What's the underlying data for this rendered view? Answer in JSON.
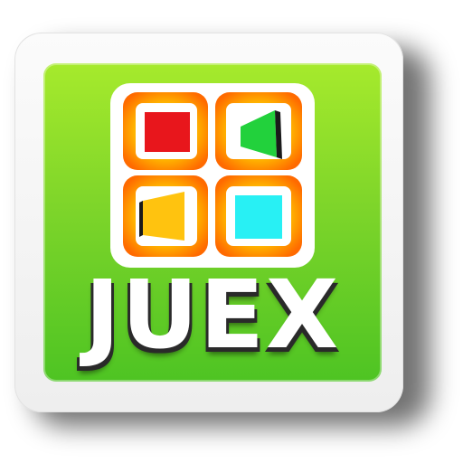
{
  "app_icon": {
    "word": "JUEX",
    "colors": {
      "panel_top": "#a6ea2c",
      "panel_bottom": "#4ec423",
      "tile_red": "#e8161c",
      "tile_green": "#22d13c",
      "tile_yellow": "#ffc30f",
      "tile_cyan": "#28f0f4",
      "tile_ring": "#ff7a00",
      "tile_glow": "#ffd84a"
    }
  }
}
